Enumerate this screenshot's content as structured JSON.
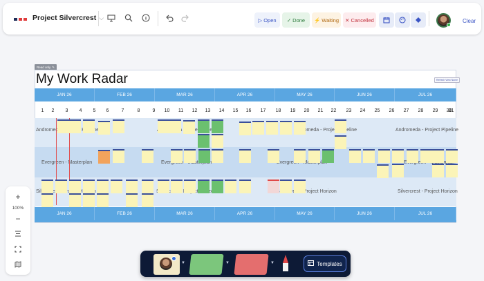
{
  "project": {
    "title": "Project Silvercrest"
  },
  "toolbar": {
    "icons": [
      "presentation-icon",
      "search-icon",
      "info-icon",
      "undo-icon",
      "redo-icon"
    ],
    "statuses": [
      {
        "label": "Open",
        "glyph": "▷",
        "bg": "#eef2fb",
        "fg": "#3a54c4"
      },
      {
        "label": "Done",
        "glyph": "✓",
        "bg": "#e6f4e8",
        "fg": "#2a7a3a"
      },
      {
        "label": "Waiting",
        "glyph": "⚡",
        "bg": "#fdf3e3",
        "fg": "#b0680f"
      },
      {
        "label": "Cancelled",
        "glyph": "✕",
        "bg": "#fdecee",
        "fg": "#c2333e"
      }
    ],
    "clear_label": "Clear"
  },
  "zoom": {
    "plus": "+",
    "level": "100%",
    "minus": "−"
  },
  "board": {
    "read_only_label": "Read only",
    "title": "My Work Radar",
    "refresh_label": "Refresh View Name",
    "months": [
      "JAN 26",
      "FEB 26",
      "MAR 26",
      "APR 26",
      "MAY 26",
      "JUN 26",
      "JUL 26"
    ],
    "days": [
      "1",
      "2",
      "3",
      "4",
      "5",
      "6",
      "7",
      "8",
      "9",
      "10",
      "11",
      "12",
      "13",
      "14",
      "15",
      "16",
      "17",
      "18",
      "19",
      "20",
      "21",
      "22",
      "23",
      "24",
      "25",
      "26",
      "27",
      "28",
      "29",
      "30",
      "31"
    ],
    "lanes": [
      {
        "name": "Andromeda - Project Pipeline"
      },
      {
        "name": "Evergreen - Masterplan"
      },
      {
        "name": "Silvercrest - Project Horizon"
      }
    ]
  },
  "dock": {
    "templates_label": "Templates"
  },
  "colors": {
    "accent": "#3a54c4",
    "month_bar": "#5aa6e1",
    "lane_a": "#dde9f6",
    "lane_b": "#c6dbf1",
    "marker": "#e05050"
  }
}
